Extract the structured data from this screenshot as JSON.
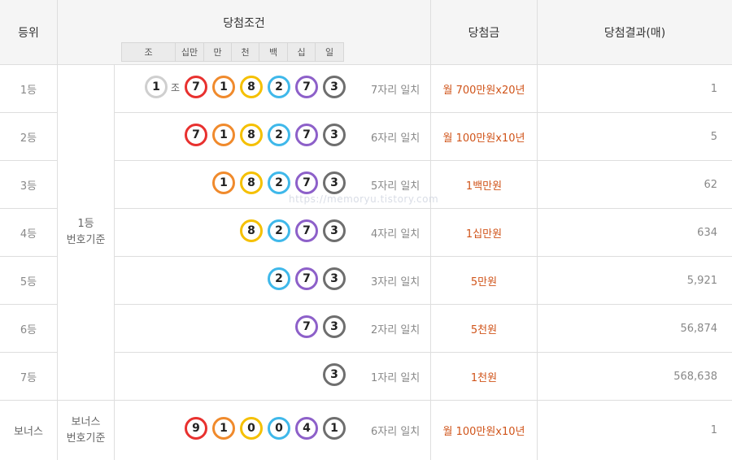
{
  "headers": {
    "rank": "등위",
    "condition": "당첨조건",
    "prize": "당첨금",
    "result": "당첨결과(매)"
  },
  "digit_headers": [
    "조",
    "십만",
    "만",
    "천",
    "백",
    "십",
    "일"
  ],
  "group_labels": {
    "main": [
      "1등",
      "번호기준"
    ],
    "bonus": [
      "보너스",
      "번호기준"
    ]
  },
  "rows": [
    {
      "rank": "1등",
      "jo": "1",
      "jo_label": "조",
      "digits": [
        "7",
        "1",
        "8",
        "2",
        "7",
        "3"
      ],
      "match": "7자리 일치",
      "prize": "월 700만원x20년",
      "count": "1"
    },
    {
      "rank": "2등",
      "digits": [
        "7",
        "1",
        "8",
        "2",
        "7",
        "3"
      ],
      "match": "6자리 일치",
      "prize": "월 100만원x10년",
      "count": "5"
    },
    {
      "rank": "3등",
      "digits": [
        "1",
        "8",
        "2",
        "7",
        "3"
      ],
      "match": "5자리 일치",
      "prize": "1백만원",
      "count": "62"
    },
    {
      "rank": "4등",
      "digits": [
        "8",
        "2",
        "7",
        "3"
      ],
      "match": "4자리 일치",
      "prize": "1십만원",
      "count": "634"
    },
    {
      "rank": "5등",
      "digits": [
        "2",
        "7",
        "3"
      ],
      "match": "3자리 일치",
      "prize": "5만원",
      "count": "5,921"
    },
    {
      "rank": "6등",
      "digits": [
        "7",
        "3"
      ],
      "match": "2자리 일치",
      "prize": "5천원",
      "count": "56,874"
    },
    {
      "rank": "7등",
      "digits": [
        "3"
      ],
      "match": "1자리 일치",
      "prize": "1천원",
      "count": "568,638"
    },
    {
      "rank": "보너스",
      "digits": [
        "9",
        "1",
        "0",
        "0",
        "4",
        "1"
      ],
      "match": "6자리 일치",
      "prize": "월 100만원x10년",
      "count": "1"
    }
  ],
  "ball_colors": {
    "jo": "#cfcfcf",
    "hundred_thousands": "#e8312f",
    "ten_thousands": "#f08a2c",
    "thousands": "#f5c000",
    "hundreds": "#3fb8ea",
    "tens": "#8d60c9",
    "ones": "#6e6e6e"
  },
  "prize_color": "#d0541a",
  "watermark": "https://memoryu.tistory.com"
}
